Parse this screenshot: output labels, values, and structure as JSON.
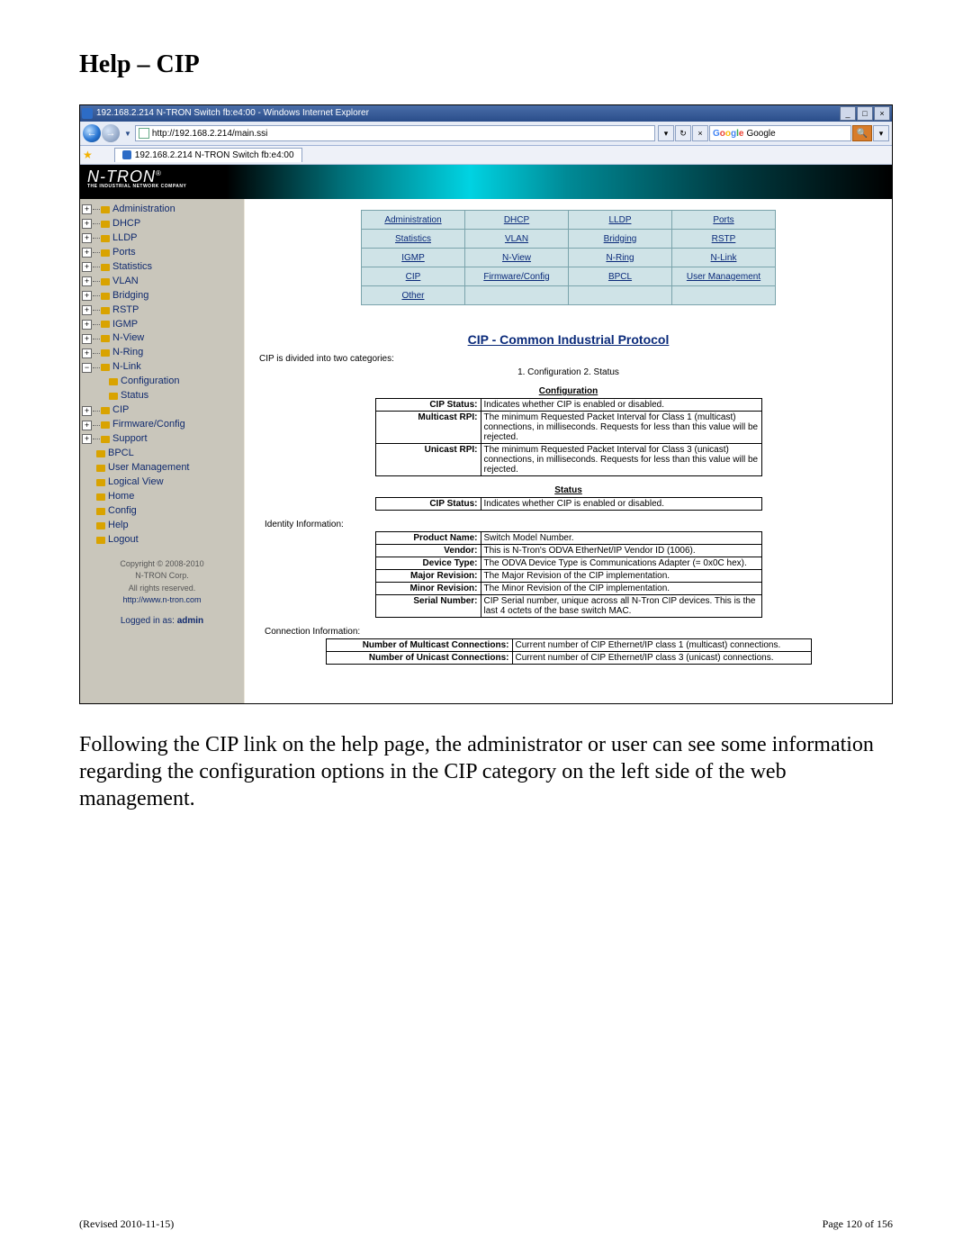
{
  "doc": {
    "heading": "Help – CIP",
    "caption": "Following the CIP link on the help page, the administrator or user can see some information regarding the configuration options in the CIP category on the left side of the web management.",
    "revised": "(Revised 2010-11-15)",
    "page_no": "Page 120 of 156"
  },
  "browser": {
    "window_title": "192.168.2.214 N-TRON Switch fb:e4:00 - Windows Internet Explorer",
    "url": "http://192.168.2.214/main.ssi",
    "tab_title": "192.168.2.214 N-TRON Switch fb:e4:00",
    "search_engine": "Google",
    "btn_min": "_",
    "btn_max": "□",
    "btn_close": "×",
    "refresh": "↻",
    "stop": "×",
    "search_icon": "🔍"
  },
  "sidebar": {
    "items": [
      {
        "exp": "+",
        "label": "Administration"
      },
      {
        "exp": "+",
        "label": "DHCP"
      },
      {
        "exp": "+",
        "label": "LLDP"
      },
      {
        "exp": "+",
        "label": "Ports"
      },
      {
        "exp": "+",
        "label": "Statistics"
      },
      {
        "exp": "+",
        "label": "VLAN"
      },
      {
        "exp": "+",
        "label": "Bridging"
      },
      {
        "exp": "+",
        "label": "RSTP"
      },
      {
        "exp": "+",
        "label": "IGMP"
      },
      {
        "exp": "+",
        "label": "N-View"
      },
      {
        "exp": "+",
        "label": "N-Ring"
      },
      {
        "exp": "−",
        "label": "N-Link"
      }
    ],
    "nlink_children": [
      {
        "label": "Configuration"
      },
      {
        "label": "Status"
      }
    ],
    "tail": [
      {
        "exp": "+",
        "label": "CIP"
      },
      {
        "exp": "+",
        "label": "Firmware/Config"
      },
      {
        "exp": "+",
        "label": "Support"
      }
    ],
    "leaf": [
      {
        "label": "BPCL"
      },
      {
        "label": "User Management"
      },
      {
        "label": "Logical View"
      },
      {
        "label": "Home"
      },
      {
        "label": "Config"
      },
      {
        "label": "Help"
      },
      {
        "label": "Logout"
      }
    ],
    "footer_l1": "Copyright © 2008-2010",
    "footer_l2": "N-TRON Corp.",
    "footer_l3": "All rights reserved.",
    "footer_url": "http://www.n-tron.com",
    "logged_in": "Logged in as:",
    "user": "admin"
  },
  "logo": {
    "brand": "N-TRON",
    "tag": "THE INDUSTRIAL NETWORK COMPANY",
    "reg": "®"
  },
  "linkgrid": {
    "r0": [
      "Administration",
      "DHCP",
      "LLDP",
      "Ports"
    ],
    "r1": [
      "Statistics",
      "VLAN",
      "Bridging",
      "RSTP"
    ],
    "r2": [
      "IGMP",
      "N-View",
      "N-Ring",
      "N-Link"
    ],
    "r3": [
      "CIP",
      "Firmware/Config",
      "BPCL",
      "User Management"
    ],
    "r4": [
      "Other",
      "",
      "",
      ""
    ]
  },
  "cip": {
    "title": "CIP - Common Industrial Protocol",
    "intro": "CIP is divided into two categories:",
    "catline": "1. Configuration   2. Status",
    "config_head": "Configuration",
    "config_rows": [
      {
        "k": "CIP Status:",
        "v": "Indicates whether CIP is enabled or disabled."
      },
      {
        "k": "Multicast RPI:",
        "v": "The minimum Requested Packet Interval for Class 1 (multicast) connections, in milliseconds. Requests for less than this value will be rejected."
      },
      {
        "k": "Unicast RPI:",
        "v": "The minimum Requested Packet Interval for Class 3 (unicast) connections, in milliseconds. Requests for less than this value will be rejected."
      }
    ],
    "status_head": "Status",
    "status_rows": [
      {
        "k": "CIP Status:",
        "v": "Indicates whether CIP is enabled or disabled."
      }
    ],
    "identity_head": "Identity Information:",
    "identity_rows": [
      {
        "k": "Product Name:",
        "v": "Switch Model Number."
      },
      {
        "k": "Vendor:",
        "v": "This is N-Tron's ODVA EtherNet/IP Vendor ID (1006)."
      },
      {
        "k": "Device Type:",
        "v": "The ODVA Device Type is Communications Adapter (= 0x0C hex)."
      },
      {
        "k": "Major Revision:",
        "v": "The Major Revision of the CIP implementation."
      },
      {
        "k": "Minor Revision:",
        "v": "The Minor Revision of the CIP implementation."
      },
      {
        "k": "Serial Number:",
        "v": "CIP Serial number, unique across all N-Tron CIP devices. This is the last 4 octets of the base switch MAC."
      }
    ],
    "conn_head": "Connection Information:",
    "conn_rows": [
      {
        "k": "Number of Multicast Connections:",
        "v": "Current number of CIP Ethernet/IP class 1 (multicast) connections."
      },
      {
        "k": "Number of Unicast Connections:",
        "v": "Current number of CIP Ethernet/IP class 3 (unicast) connections."
      }
    ]
  }
}
